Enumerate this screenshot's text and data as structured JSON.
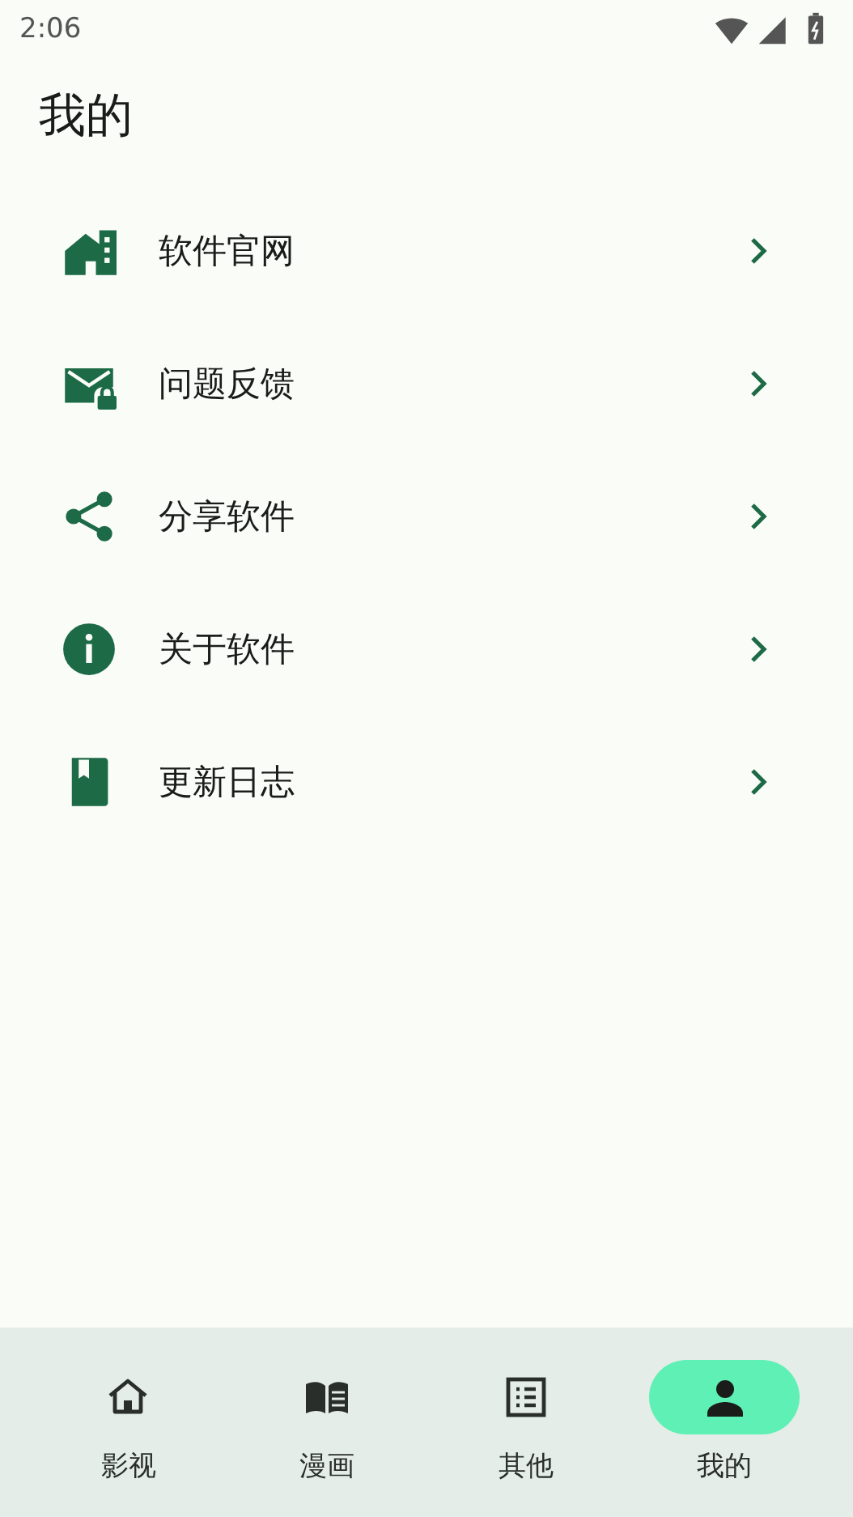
{
  "status_bar": {
    "time": "2:06"
  },
  "title": "我的",
  "menu_items": [
    {
      "label": "软件官网",
      "kind": "website"
    },
    {
      "label": "问题反馈",
      "kind": "feedback"
    },
    {
      "label": "分享软件",
      "kind": "share"
    },
    {
      "label": "关于软件",
      "kind": "about"
    },
    {
      "label": "更新日志",
      "kind": "changelog"
    }
  ],
  "bottom_nav": [
    {
      "label": "影视",
      "kind": "home",
      "selected": false
    },
    {
      "label": "漫画",
      "kind": "book",
      "selected": false
    },
    {
      "label": "其他",
      "kind": "list",
      "selected": false
    },
    {
      "label": "我的",
      "kind": "person",
      "selected": true
    }
  ]
}
